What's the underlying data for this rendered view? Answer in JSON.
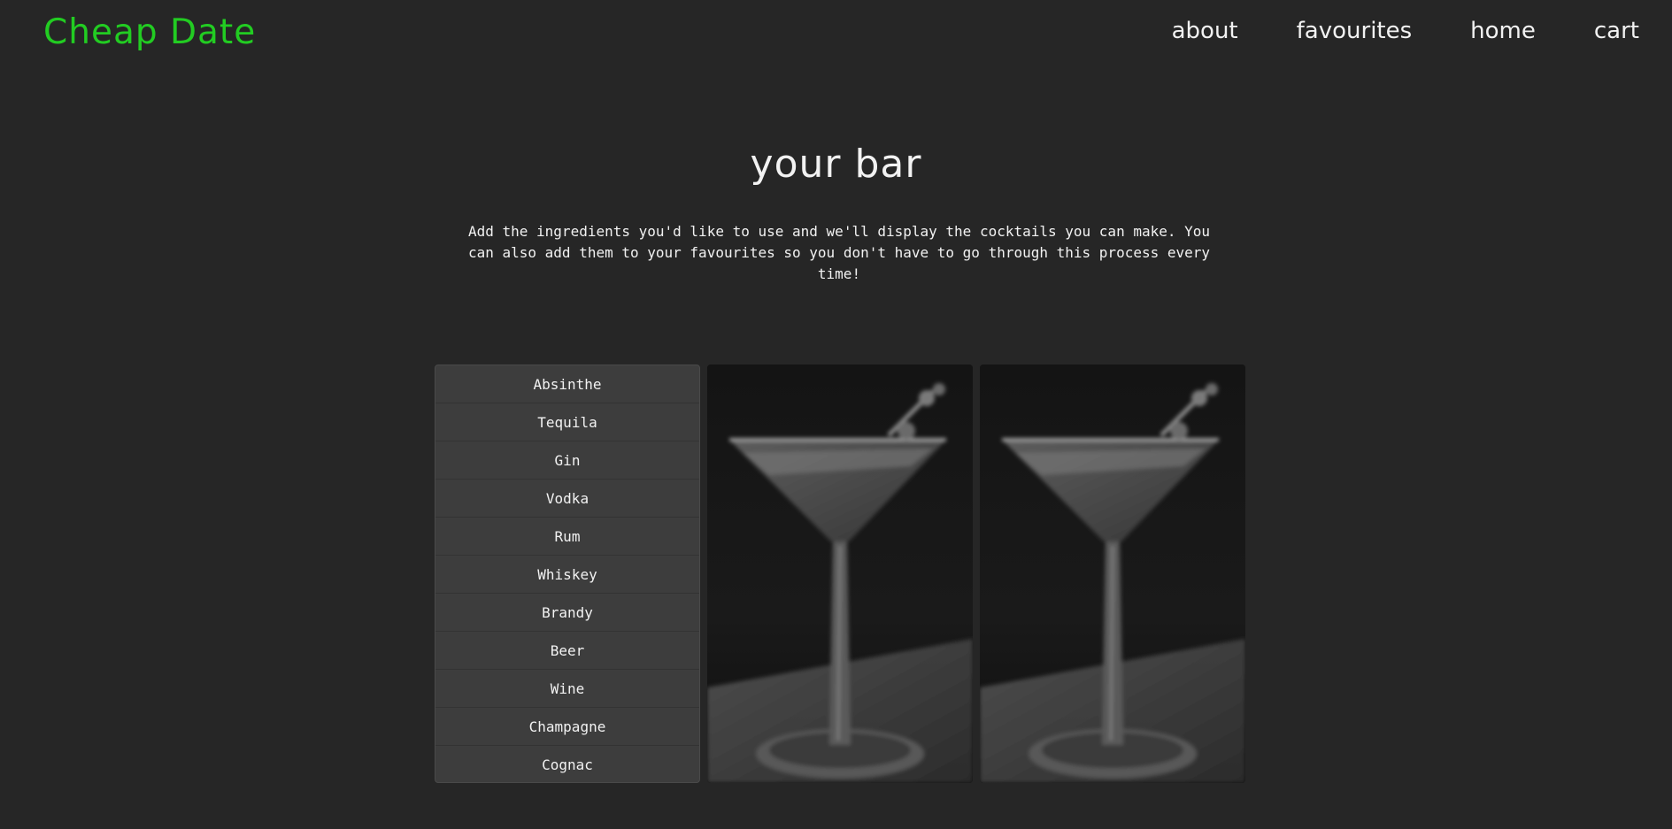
{
  "header": {
    "logo": "Cheap Date",
    "nav": [
      {
        "label": "about"
      },
      {
        "label": "favourites"
      },
      {
        "label": "home"
      },
      {
        "label": "cart"
      }
    ]
  },
  "main": {
    "title": "your bar",
    "description": "Add the ingredients you'd like to use and we'll display the cocktails you can make. You can also add them to your favourites so you don't have to go through this process every time!",
    "ingredients": [
      {
        "label": "Absinthe"
      },
      {
        "label": "Tequila"
      },
      {
        "label": "Gin"
      },
      {
        "label": "Vodka"
      },
      {
        "label": "Rum"
      },
      {
        "label": "Whiskey"
      },
      {
        "label": "Brandy"
      },
      {
        "label": "Beer"
      },
      {
        "label": "Wine"
      },
      {
        "label": "Champagne"
      },
      {
        "label": "Cognac"
      }
    ],
    "cocktail_cards": [
      {
        "image": "martini-glass-photo"
      },
      {
        "image": "martini-glass-photo"
      }
    ]
  },
  "colors": {
    "background": "#262626",
    "logo": "#22cc22",
    "list_background": "#3d3d3d",
    "text": "#f2f2f2"
  }
}
